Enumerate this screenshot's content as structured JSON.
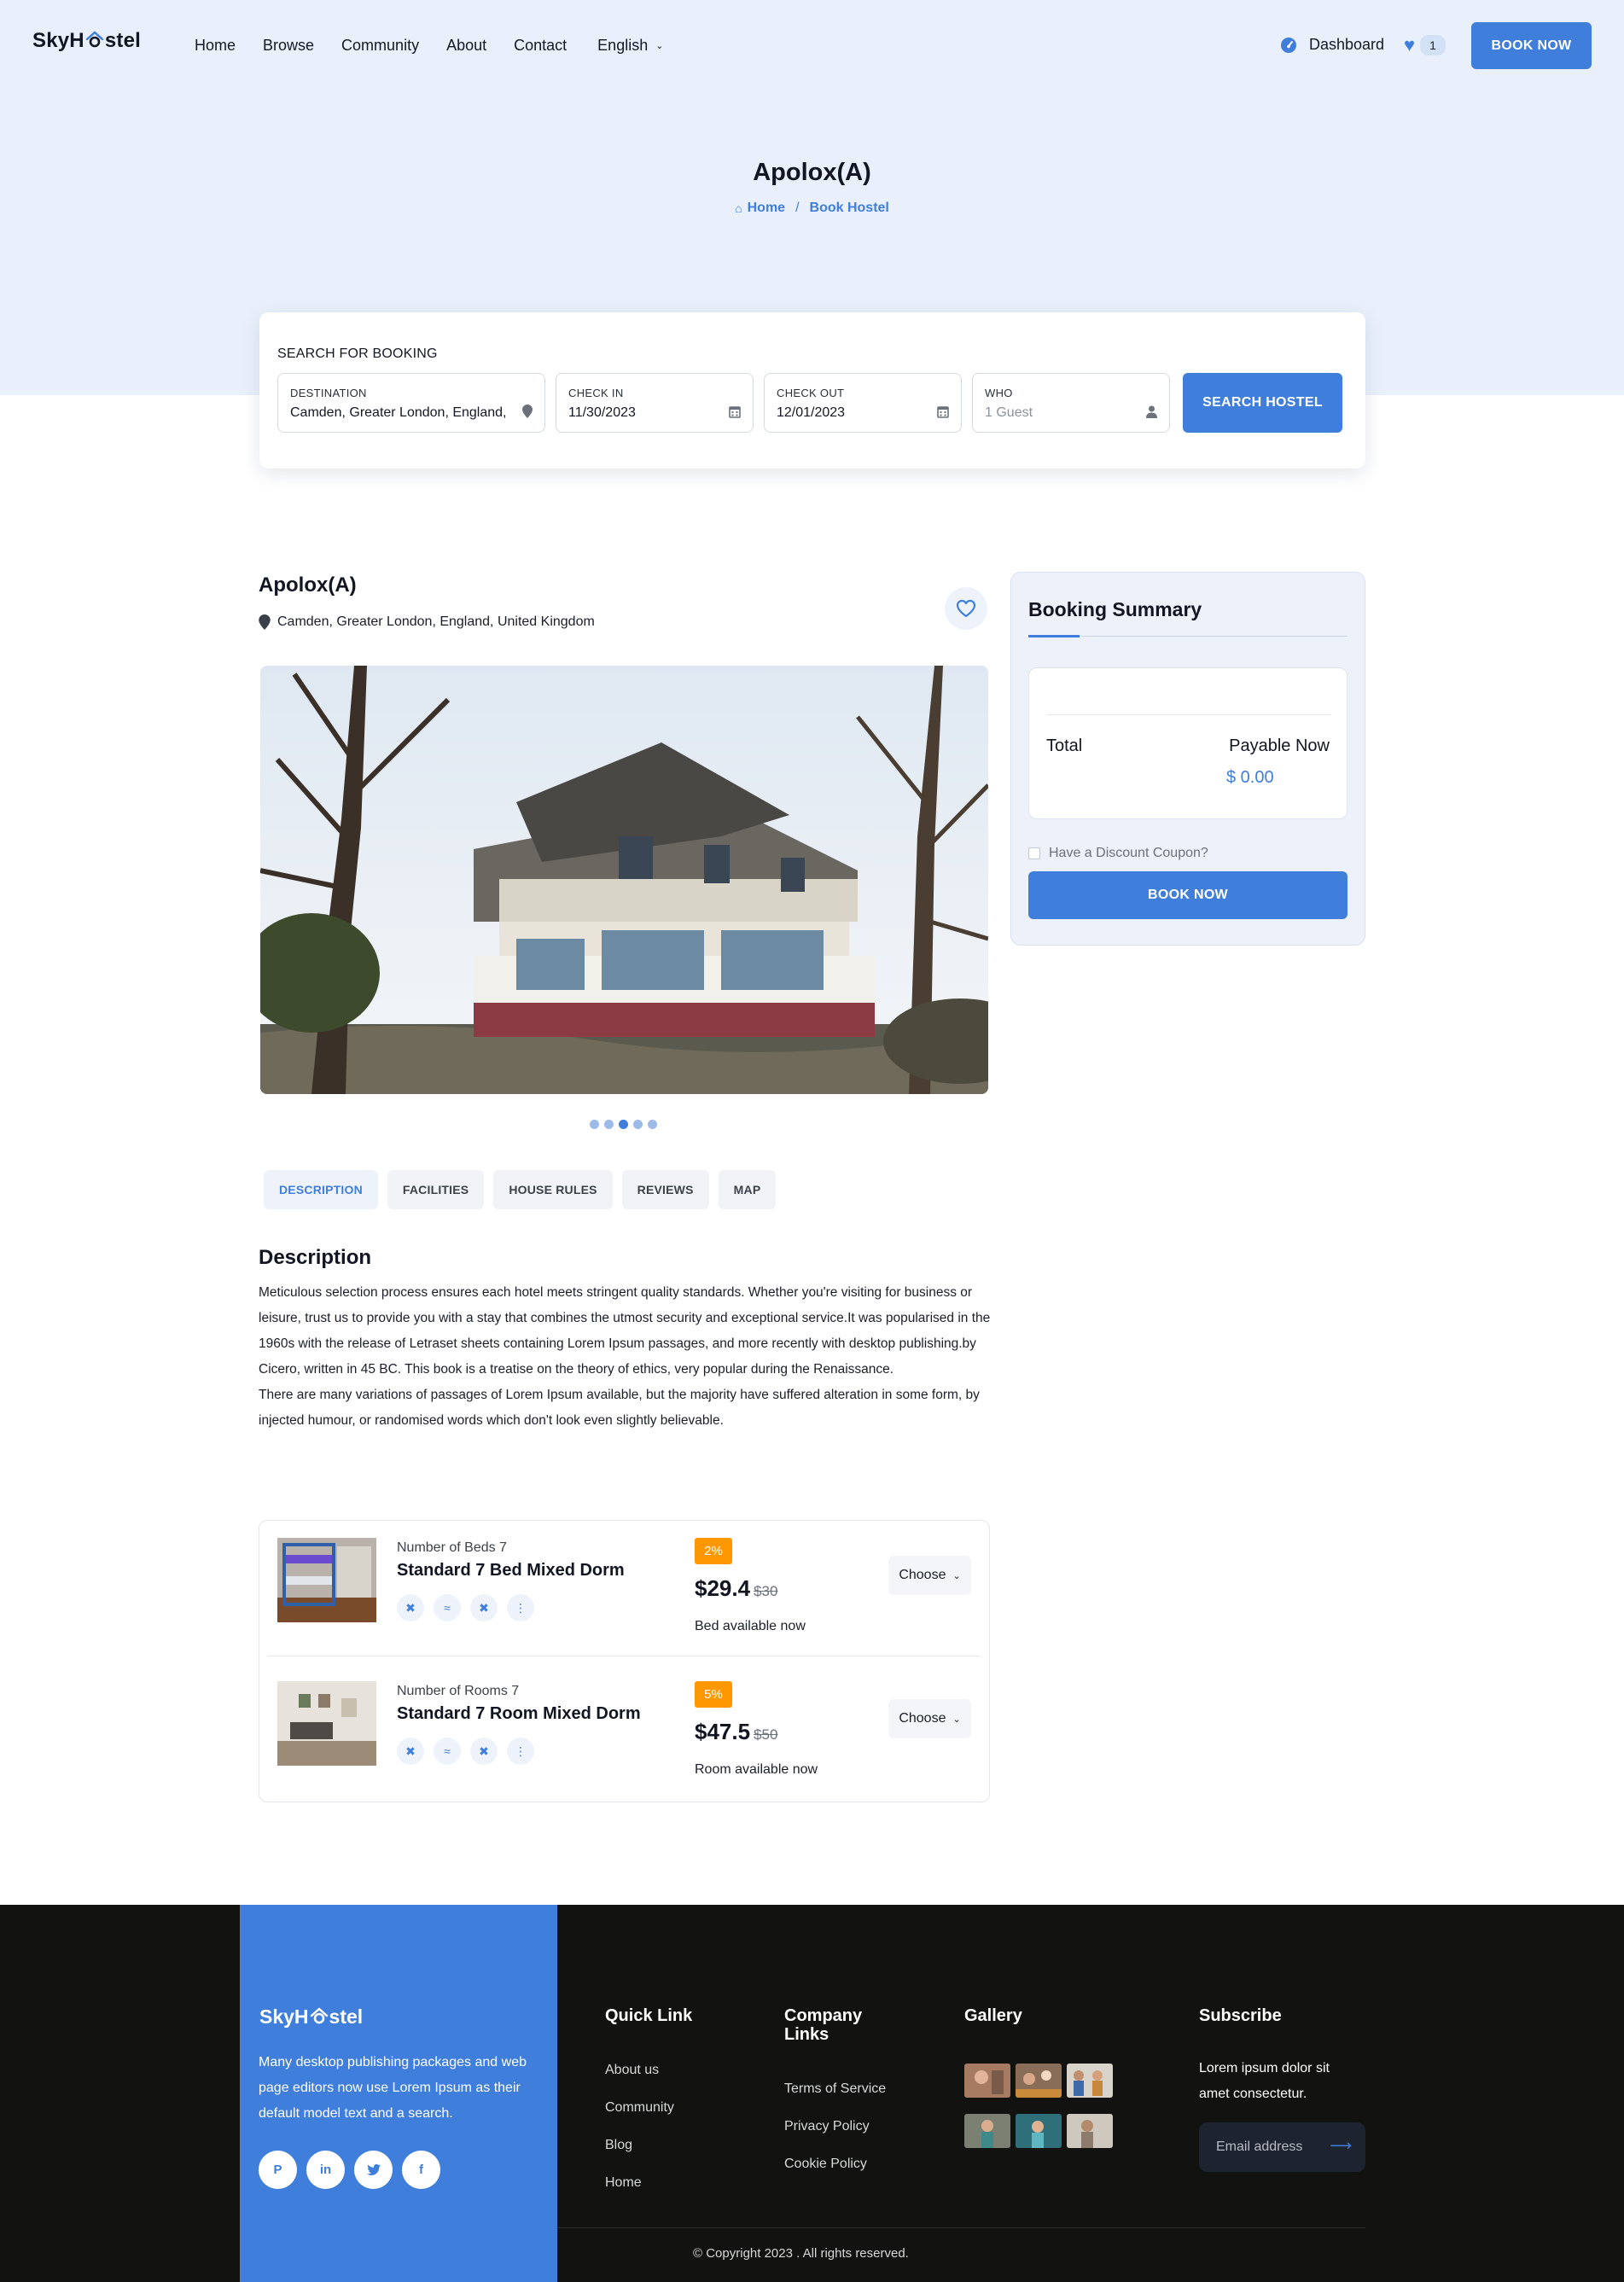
{
  "brand": {
    "name_left": "SkyH",
    "name_right": "stel",
    "accent": "#3f7edb"
  },
  "nav": {
    "links": [
      "Home",
      "Browse",
      "Community",
      "About",
      "Contact"
    ],
    "language": "English",
    "dashboard": "Dashboard",
    "wishlist_count": "1",
    "book_now": "BOOK NOW"
  },
  "hero": {
    "title": "Apolox(A)",
    "breadcrumb": {
      "home": "Home",
      "sep": "/",
      "current": "Book Hostel"
    }
  },
  "search": {
    "heading": "SEARCH FOR BOOKING",
    "destination": {
      "label": "DESTINATION",
      "value": "Camden, Greater London, England, United Kingdom"
    },
    "check_in": {
      "label": "CHECK IN",
      "value": "11/30/2023"
    },
    "check_out": {
      "label": "CHECK OUT",
      "value": "12/01/2023"
    },
    "who": {
      "label": "WHO",
      "placeholder": "1 Guest"
    },
    "button": "SEARCH HOSTEL"
  },
  "property": {
    "name": "Apolox(A)",
    "location": "Camden, Greater London, England, United Kingdom",
    "carousel": {
      "count": 5,
      "active_index": 2
    }
  },
  "tabs": [
    "DESCRIPTION",
    "FACILITIES",
    "HOUSE RULES",
    "REVIEWS",
    "MAP"
  ],
  "description": {
    "title": "Description",
    "p1": "Meticulous selection process ensures each hotel meets stringent quality standards. Whether you're visiting for business or leisure, trust us to provide you with a stay that combines the utmost security and exceptional service.It was popularised in the 1960s with the release of Letraset sheets containing Lorem Ipsum passages, and more recently with desktop publishing.by Cicero, written in 45 BC. This book is a treatise on the theory of ethics, very popular during the Renaissance.",
    "p2": "There are many variations of passages of Lorem Ipsum available, but the majority have suffered alteration in some form, by injected humour, or randomised words which don't look even slightly believable."
  },
  "rooms": [
    {
      "sub": "Number of Beds 7",
      "name": "Standard 7 Bed Mixed Dorm",
      "discount": "2%",
      "price": "$29.4",
      "old_price": "$30",
      "availability": "Bed available now",
      "choose": "Choose"
    },
    {
      "sub": "Number of Rooms 7",
      "name": "Standard 7 Room Mixed Dorm",
      "discount": "5%",
      "price": "$47.5",
      "old_price": "$50",
      "availability": "Room available now",
      "choose": "Choose"
    }
  ],
  "summary": {
    "title": "Booking Summary",
    "total_label": "Total",
    "payable_label": "Payable Now",
    "amount": "$ 0.00",
    "coupon": "Have a Discount Coupon?",
    "book_now": "BOOK NOW"
  },
  "footer": {
    "about": "Many desktop publishing packages and web page editors now use Lorem Ipsum as their default model text and a search.",
    "socials": [
      "pinterest-icon",
      "linkedin-icon",
      "twitter-icon",
      "facebook-icon"
    ],
    "quick_link": {
      "title": "Quick Link",
      "items": [
        "About us",
        "Community",
        "Blog",
        "Home"
      ]
    },
    "company_links": {
      "title": "Company Links",
      "items": [
        "Terms of Service",
        "Privacy Policy",
        "Cookie Policy"
      ]
    },
    "gallery": {
      "title": "Gallery"
    },
    "subscribe": {
      "title": "Subscribe",
      "text": "Lorem ipsum dolor sit amet consectetur.",
      "placeholder": "Email address"
    },
    "copyright": "© Copyright 2023 . All rights reserved."
  }
}
